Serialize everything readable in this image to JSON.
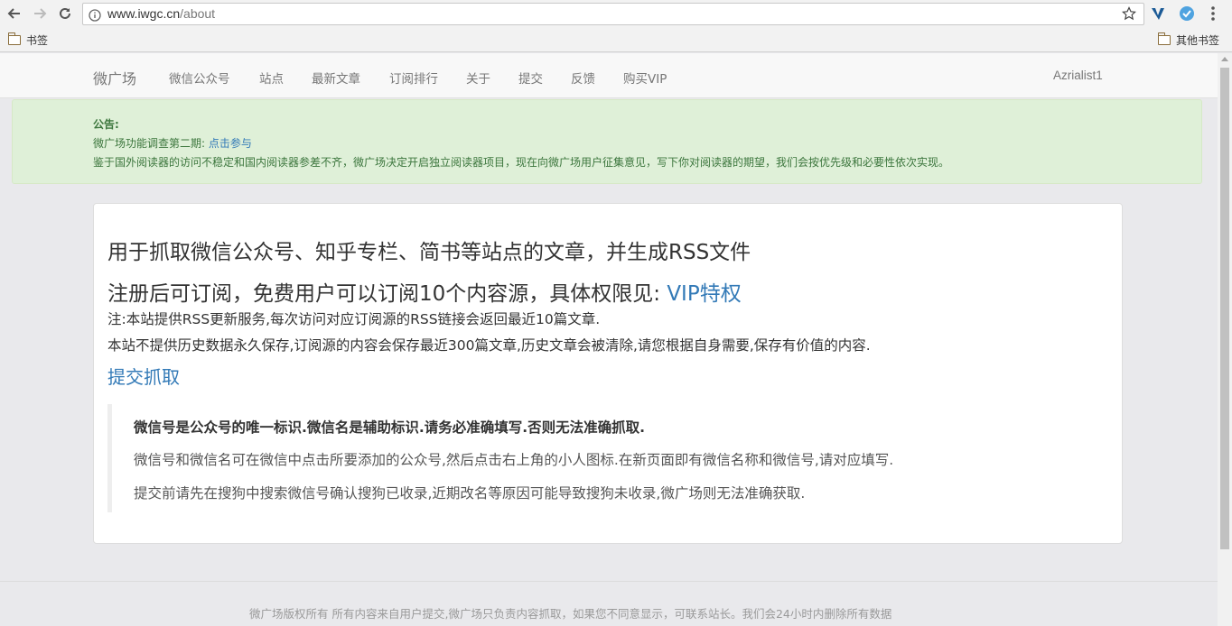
{
  "browser": {
    "url_host": "www.iwgc.cn",
    "url_path": "/about",
    "bookmarks": {
      "left_label": "书签",
      "right_label": "其他书签"
    }
  },
  "navbar": {
    "brand": "微广场",
    "items": [
      "微信公众号",
      "站点",
      "最新文章",
      "订阅排行",
      "关于",
      "提交",
      "反馈",
      "购买VIP"
    ],
    "user": "Azrialist1"
  },
  "notice": {
    "title": "公告:",
    "line1_text": "微广场功能调查第二期: ",
    "line1_link": "点击参与",
    "line2": "鉴于国外阅读器的访问不稳定和国内阅读器参差不齐，微广场决定开启独立阅读器项目，现在向微广场用户征集意见，写下你对阅读器的期望，我们会按优先级和必要性依次实现。"
  },
  "content": {
    "heading1": "用于抓取微信公众号、知乎专栏、简书等站点的文章，并生成RSS文件",
    "heading2_text": "注册后可订阅，免费用户可以订阅10个内容源，具体权限见: ",
    "heading2_link": "VIP特权",
    "note1": "注:本站提供RSS更新服务,每次访问对应订阅源的RSS链接会返回最近10篇文章.",
    "note2": "本站不提供历史数据永久保存,订阅源的内容会保存最近300篇文章,历史文章会被清除,请您根据自身需要,保存有价值的内容.",
    "submit_link": "提交抓取",
    "quote_bold": "微信号是公众号的唯一标识.微信名是辅助标识.请务必准确填写.否则无法准确抓取.",
    "quote_line2": "微信号和微信名可在微信中点击所要添加的公众号,然后点击右上角的小人图标.在新页面即有微信名称和微信号,请对应填写.",
    "quote_line3": "提交前请先在搜狗中搜索微信号确认搜狗已收录,近期改名等原因可能导致搜狗未收录,微广场则无法准确获取."
  },
  "footer": {
    "text": "微广场版权所有 所有内容来自用户提交,微广场只负责内容抓取，如果您不同意显示，可联系站长。我们会24小时内删除所有数据"
  }
}
